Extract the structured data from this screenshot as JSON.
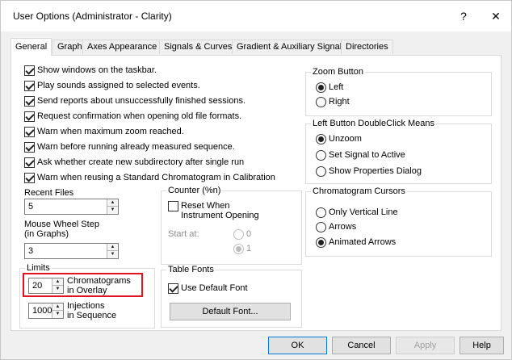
{
  "window": {
    "title": "User Options (Administrator - Clarity)",
    "help_glyph": "?",
    "close_glyph": "✕"
  },
  "tabs": [
    {
      "label": "General",
      "active": true
    },
    {
      "label": "Graph"
    },
    {
      "label": "Axes Appearance"
    },
    {
      "label": "Signals & Curves"
    },
    {
      "label": "Gradient & Auxiliary Signals"
    },
    {
      "label": "Directories"
    }
  ],
  "general": {
    "checkboxes": [
      {
        "label": "Show windows on the taskbar.",
        "checked": true
      },
      {
        "label": "Play sounds assigned to selected events.",
        "checked": true
      },
      {
        "label": "Send reports about unsuccessfully finished sessions.",
        "checked": true
      },
      {
        "label": "Request confirmation when opening old file formats.",
        "checked": true
      },
      {
        "label": "Warn when maximum zoom reached.",
        "checked": true
      },
      {
        "label": "Warn before running already measured sequence.",
        "checked": true
      },
      {
        "label": "Ask whether create new subdirectory after single run",
        "checked": true
      },
      {
        "label": "Warn when reusing a Standard Chromatogram in Calibration",
        "checked": true
      }
    ],
    "recent_files": {
      "label": "Recent Files",
      "value": "5"
    },
    "mouse_wheel": {
      "label_line1": "Mouse Wheel Step",
      "label_line2": "(in Graphs)",
      "value": "3"
    },
    "limits": {
      "title": "Limits",
      "chromatograms": {
        "value": "20",
        "label_line1": "Chromatograms",
        "label_line2": "in Overlay"
      },
      "injections": {
        "value": "1000",
        "label_line1": "Injections",
        "label_line2": "in Sequence"
      }
    },
    "counter": {
      "title": "Counter (%n)",
      "reset_line1": "Reset When",
      "reset_line2": "Instrument Opening",
      "reset_checked": false,
      "start_label": "Start at:",
      "options": [
        {
          "label": "0",
          "selected": false
        },
        {
          "label": "1",
          "selected": true
        }
      ]
    },
    "table_fonts": {
      "title": "Table Fonts",
      "use_default_label": "Use Default Font",
      "use_default_checked": true,
      "default_font_button": "Default Font..."
    },
    "zoom_button": {
      "title": "Zoom Button",
      "options": [
        {
          "label": "Left",
          "selected": true
        },
        {
          "label": "Right",
          "selected": false
        }
      ]
    },
    "left_double_click": {
      "title": "Left Button DoubleClick Means",
      "options": [
        {
          "label": "Unzoom",
          "selected": true
        },
        {
          "label": "Set Signal to Active",
          "selected": false
        },
        {
          "label": "Show Properties Dialog",
          "selected": false
        }
      ]
    },
    "cursors": {
      "title": "Chromatogram Cursors",
      "options": [
        {
          "label": "Only Vertical Line",
          "selected": false
        },
        {
          "label": "Arrows",
          "selected": false
        },
        {
          "label": "Animated Arrows",
          "selected": true
        }
      ]
    }
  },
  "footer": {
    "ok": "OK",
    "cancel": "Cancel",
    "apply": "Apply",
    "help": "Help"
  },
  "colors": {
    "highlight": "#e0141e",
    "default_button_border": "#0078d7"
  }
}
